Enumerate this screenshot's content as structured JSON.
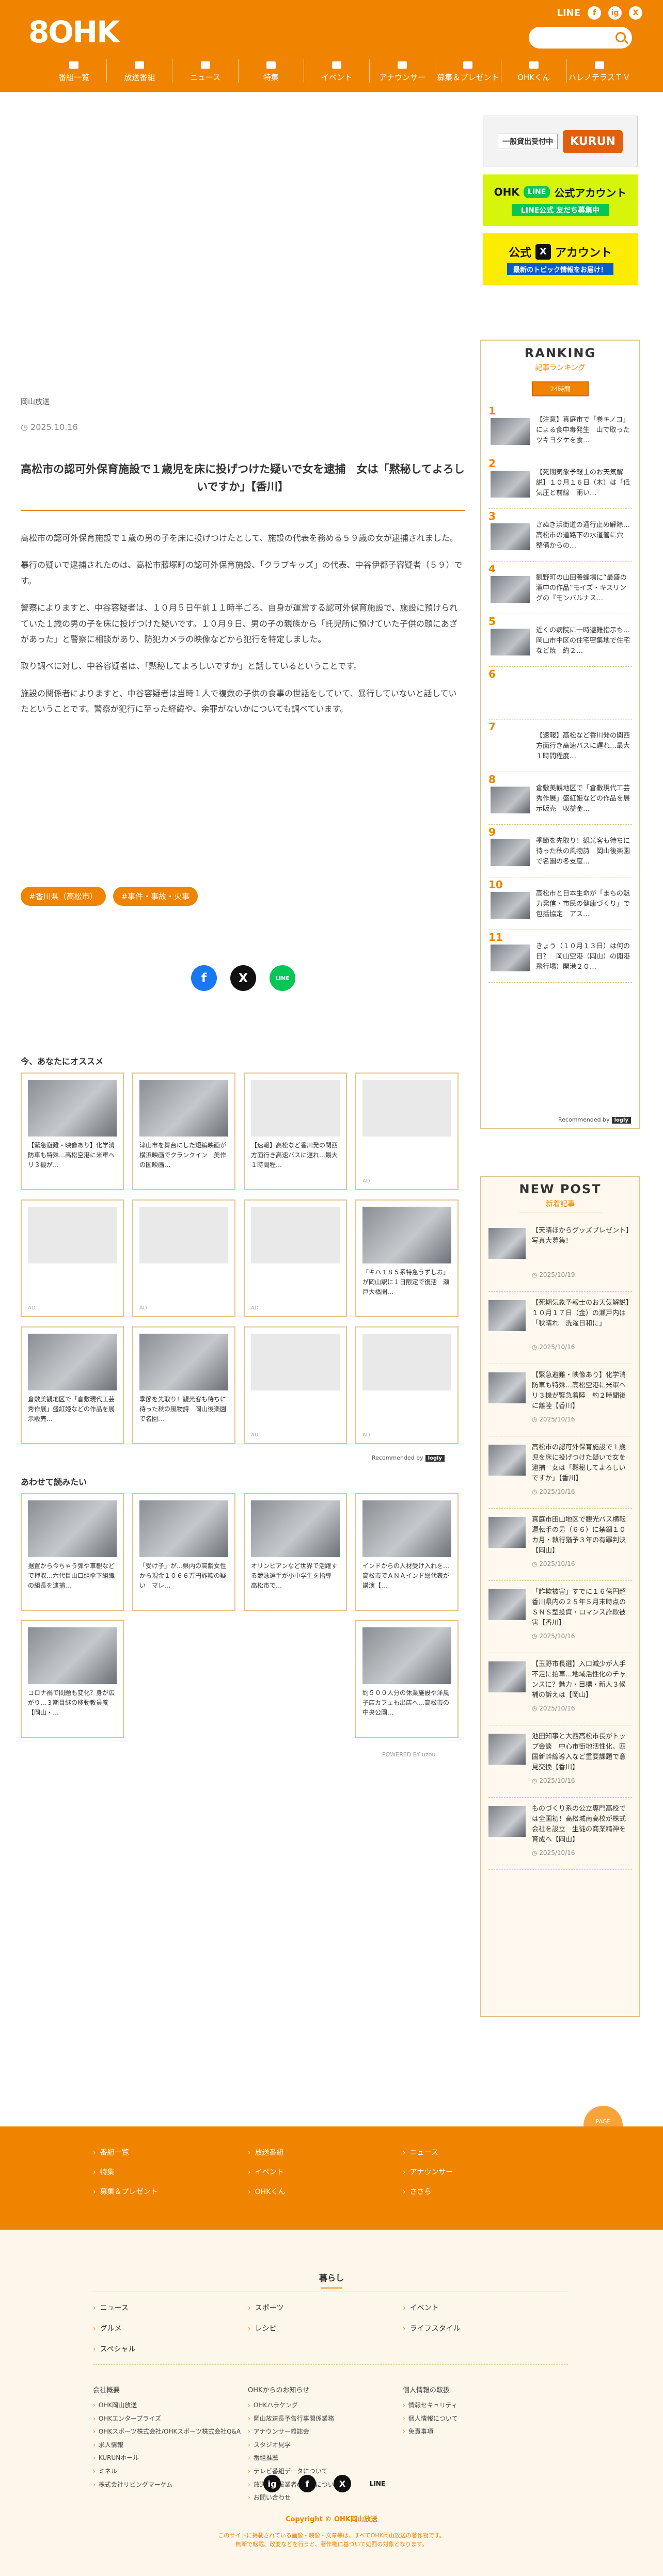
{
  "header": {
    "logo": "8OHK",
    "social": [
      "LINE",
      "f",
      "ig",
      "X"
    ],
    "search_placeholder": "",
    "nav": [
      "番組一覧",
      "放送番組",
      "ニュース",
      "特集",
      "イベント",
      "アナウンサー",
      "募集＆プレゼント",
      "OHKくん",
      "ハレノテラスＴＶ"
    ]
  },
  "article": {
    "category": "岡山放送",
    "date": "◷ 2025.10.16",
    "title": "高松市の認可外保育施設で１歳児を床に投げつけた疑いで女を逮捕　女は「黙秘してよろしいですか」【香川】",
    "body": [
      "高松市の認可外保育施設で１歳の男の子を床に投げつけたとして、施設の代表を務める５９歳の女が逮捕されました。",
      "暴行の疑いで逮捕されたのは、高松市藤塚町の認可外保育施設、「クラブキッズ」の代表、中谷伊都子容疑者（５９）です。",
      "警察によりますと、中谷容疑者は、１０月５日午前１１時半ごろ、自身が運営する認可外保育施設で、施設に預けられていた１歳の男の子を床に投げつけた疑いです。１０月９日、男の子の親族から「託児所に預けていた子供の顔にあざがあった」と警察に相談があり、防犯カメラの映像などから犯行を特定しました。",
      "取り調べに対し、中谷容疑者は、「黙秘してよろしいですか」と話しているということです。",
      "施設の関係者によりますと、中谷容疑者は当時１人で複数の子供の食事の世話をしていて、暴行していないと話していたということです。警察が犯行に至った経緯や、余罪がないかについても調べています。"
    ],
    "tags": [
      "#香川県（高松市）",
      "#事件・事故・火事"
    ],
    "share": [
      "f",
      "X",
      "LINE"
    ]
  },
  "recommend": {
    "heading": "今、あなたにオススメ",
    "cards": [
      {
        "text": "【緊急避難・映像あり】化学消防車も特殊…高松空港に米軍ヘリ３機が…",
        "photo": true,
        "ad": ""
      },
      {
        "text": "津山市を舞台にした短編映画が横浜映画でクランクイン　美作の国映画…",
        "photo": true,
        "ad": ""
      },
      {
        "text": "【速報】高松など香川発の関西方面行き高速バスに遅れ…最大１時間程…",
        "photo": false,
        "ad": ""
      },
      {
        "text": "",
        "photo": false,
        "ad": "AD"
      },
      {
        "text": "",
        "photo": false,
        "ad": "AD"
      },
      {
        "text": "",
        "photo": false,
        "ad": "AD"
      },
      {
        "text": "",
        "photo": false,
        "ad": "AD"
      },
      {
        "text": "「キハ１８５系特急うずしお」が岡山駅に１日限定で復活　瀬戸大橋開…",
        "photo": true,
        "ad": ""
      },
      {
        "text": "倉敷美観地区で「倉敷現代工芸秀作展」盛紅姫などの作品を展示販売…",
        "photo": true,
        "ad": ""
      },
      {
        "text": "季節を先取り！観光客も待ちに待った秋の風物詩　岡山後楽園で名園…",
        "photo": true,
        "ad": ""
      },
      {
        "text": "",
        "photo": false,
        "ad": "AD"
      },
      {
        "text": "",
        "photo": false,
        "ad": "AD"
      }
    ],
    "recommended_by": "Recommended by",
    "recommended_brand": "logly"
  },
  "related": {
    "heading": "あわせて読みたい",
    "cards": [
      {
        "text": "据置から今ちゃう弾や車観などで押収…六代目山口組傘下組織の組長を逮捕…",
        "photo": true
      },
      {
        "text": "「受け子」が…県内の高齢女性から現金１０６６万円詐欺の疑い　マレ…",
        "photo": true
      },
      {
        "text": "オリンピアンなど世界で活躍する競泳選手が小中学生を指導　高松市で…",
        "photo": true
      },
      {
        "text": "インドからの人材受け入れを…高松市でＡＮＡインド総代表が講演【…",
        "photo": true
      },
      {
        "text": "コロナ禍で問題も変化？身が広がり…３期目継の移動教員養【岡山・…",
        "photo": true
      },
      {
        "text": "約５００人分の休業施設や洋風子店カフェも出店へ…高松市の中央公園…",
        "photo": true
      }
    ],
    "powered_by": "POWERED BY uzou"
  },
  "sidebar": {
    "banner1_tag": "一般貸出受付中",
    "banner1_brand": "KURUN",
    "banner2_line": "LINE",
    "banner2_text": "公式アカウント",
    "banner2_sub": "LINE公式 友だち募集中",
    "banner3_brand": "OHK",
    "banner3_text": "公式",
    "banner3_x": "X",
    "banner3_acc": "アカウント",
    "banner3_sub": "最新のトピック情報をお届け！",
    "ranking": {
      "heading": "RANKING",
      "sub": "記事ランキング",
      "tab": "24時間",
      "items": [
        {
          "n": "1",
          "text": "【注意】真庭市で「巻キノコ」による食中毒発生　山で取ったツキヨタケを食…",
          "photo": true
        },
        {
          "n": "2",
          "text": "【死期気象予報士のお天気解説】１０月１６日（木）は「低気圧と前線　雨い…",
          "photo": true
        },
        {
          "n": "3",
          "text": "さぬき浜街道の通行止め解除…高松市の道路下の水道管に穴　整備からの…",
          "photo": true
        },
        {
          "n": "4",
          "text": "観野町の山田養蜂場に“最盛の酒中の作品”モイズ・キスリングの『モンパルナス…",
          "photo": true
        },
        {
          "n": "5",
          "text": "近くの病院に一時避難指示も…岡山市中区の住宅密集地で住宅など焼　約２…",
          "photo": true
        },
        {
          "n": "6",
          "text": "",
          "photo": false
        },
        {
          "n": "7",
          "text": "【速報】高松など香川発の関西方面行き高速バスに遅れ…最大１時間程度…",
          "photo": false
        },
        {
          "n": "8",
          "text": "倉敷美観地区で「倉敷現代工芸秀作展」盛紅姫などの作品を展示販売　収益金…",
          "photo": true
        },
        {
          "n": "9",
          "text": "季節を先取り！観光客も待ちに待った秋の風物詩　岡山後楽園で名園の冬支度…",
          "photo": true
        },
        {
          "n": "10",
          "text": "高松市と日本生命が「まちの魅力発信・市民の健康づくり」で包括協定　アス…",
          "photo": true
        },
        {
          "n": "11",
          "text": "きょう（１０月１３日）は何の日？　岡山空港（岡山）の開港飛行場）開港２０…",
          "photo": true
        }
      ],
      "recommended_by": "Recommended by",
      "recommended_brand": "logly"
    },
    "newpost": {
      "heading": "NEW POST",
      "sub": "新着記事",
      "items": [
        {
          "text": "【天晴ほからグッズプレゼント】写真大募集！",
          "date": "◷ 2025/10/19"
        },
        {
          "text": "【死期気象予報士のお天気解説】１０月１７日（金）の瀬戸内は「秋晴れ　洗濯日和に」",
          "date": "◷ 2025/10/16"
        },
        {
          "text": "【緊急避難・映像あり】化学消防車も特殊…高松空港に米軍ヘリ３機が緊急着陸　約２時間後に離陸【香川】",
          "date": "◷ 2025/10/16"
        },
        {
          "text": "高松市の認可外保育施設で１歳児を床に投げつけた疑いで女を逮捕　女は「黙秘してよろしいですか」【香川】",
          "date": "◷ 2025/10/16"
        },
        {
          "text": "真庭市田山地区で観光バス横転　運転手の男（６６）に禁錮１０カ月・執行猶予３年の有罪判決【岡山】",
          "date": "◷ 2025/10/16"
        },
        {
          "text": "「詐欺被害」すでに１６億円超　香川県内の２５年５月末時点のＳＮＳ型投資・ロマンス詐欺被害【香川】",
          "date": "◷ 2025/10/16"
        },
        {
          "text": "【玉野市長選】入口減少が人手不足に拍車…地域活性化のチャンスに？魅力・目標・新人３候補の訴えは【岡山】",
          "date": "◷ 2025/10/16"
        },
        {
          "text": "池田知事と大西高松市長がトップ会談　中心市街地活性化、四国新幹線導入など重要課題で意見交換【香川】",
          "date": "◷ 2025/10/16"
        },
        {
          "text": "ものづくり系の公立専門高校では全国初！高松城南高校が株式会社を設立　生徒の商業精神を育成へ【岡山】",
          "date": "◷ 2025/10/16"
        }
      ]
    }
  },
  "pagetop": "PAGE\nTOP",
  "footer": {
    "nav": [
      "番組一覧",
      "放送番組",
      "ニュース",
      "特集",
      "イベント",
      "アナウンサー",
      "募集＆プレゼント",
      "OHKくん",
      "ささら"
    ],
    "kurashi_heading": "暮らし",
    "kurashi": [
      "ニュース",
      "スポーツ",
      "イベント",
      "グルメ",
      "レシピ",
      "ライフスタイル",
      "スペシャル"
    ],
    "col1_h": "会社概要",
    "col1": [
      "OHK岡山放送",
      "OHKエンタープライズ",
      "OHKスポーツ株式会社/OHKスポーツ株式会社Q&A",
      "求人情報",
      "KURUNホール",
      "ミネル",
      "株式会社リビングマーケム"
    ],
    "col2_h": "OHKからのお知らせ",
    "col2": [
      "OHKハラケング",
      "岡山放送長予告行事関係業務",
      "アナウンサー雑誌会",
      "スタジオ見学",
      "番組推薦",
      "テレビ番組データについて",
      "放送・所属業者の事務について",
      "お問い合わせ"
    ],
    "col3_h": "個人情報の取扱",
    "col3": [
      "情報セキュリティ",
      "個人情報について",
      "免責事項"
    ],
    "social": [
      "ig",
      "f",
      "X",
      "LINE"
    ],
    "copyright": "Copyright © OHK岡山放送",
    "note1": "このサイトに掲載されている画像・映像・文章等は、すべてOHK岡山放送の著作物です。",
    "note2": "無断で転載、改変などを行うと、著作権に基づいて処罰の対象となります。"
  }
}
